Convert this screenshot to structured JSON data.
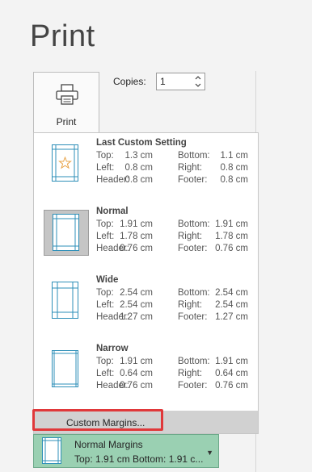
{
  "page": {
    "title": "Print"
  },
  "print_button": {
    "label": "Print",
    "icon": "printer-icon"
  },
  "copies": {
    "label": "Copies:",
    "value": "1"
  },
  "margin_options": [
    {
      "name": "Last Custom Setting",
      "icon": "star-page-icon",
      "selected": false,
      "rows": [
        [
          "Top:",
          "1.3 cm",
          "Bottom:",
          "1.1 cm"
        ],
        [
          "Left:",
          "0.8 cm",
          "Right:",
          "0.8 cm"
        ],
        [
          "Header:",
          "0.8 cm",
          "Footer:",
          "0.8 cm"
        ]
      ]
    },
    {
      "name": "Normal",
      "icon": "page-margins-icon",
      "selected": true,
      "rows": [
        [
          "Top:",
          "1.91 cm",
          "Bottom:",
          "1.91 cm"
        ],
        [
          "Left:",
          "1.78 cm",
          "Right:",
          "1.78 cm"
        ],
        [
          "Header:",
          "0.76 cm",
          "Footer:",
          "0.76 cm"
        ]
      ]
    },
    {
      "name": "Wide",
      "icon": "page-margins-icon",
      "selected": false,
      "rows": [
        [
          "Top:",
          "2.54 cm",
          "Bottom:",
          "2.54 cm"
        ],
        [
          "Left:",
          "2.54 cm",
          "Right:",
          "2.54 cm"
        ],
        [
          "Header:",
          "1.27 cm",
          "Footer:",
          "1.27 cm"
        ]
      ]
    },
    {
      "name": "Narrow",
      "icon": "page-margins-icon",
      "selected": false,
      "rows": [
        [
          "Top:",
          "1.91 cm",
          "Bottom:",
          "1.91 cm"
        ],
        [
          "Left:",
          "0.64 cm",
          "Right:",
          "0.64 cm"
        ],
        [
          "Header:",
          "0.76 cm",
          "Footer:",
          "0.76 cm"
        ]
      ]
    }
  ],
  "custom_margins": {
    "label": "Custom Margins..."
  },
  "margins_dropdown": {
    "name": "Normal Margins",
    "summary": "Top: 1.91 cm Bottom: 1.91 c...",
    "icon": "page-margins-icon"
  },
  "colors": {
    "selected_margin_button": "#9ad0b2",
    "highlight_border": "#e0383a",
    "page_lines": "#2e8fb8",
    "star": "#e8a44a"
  }
}
